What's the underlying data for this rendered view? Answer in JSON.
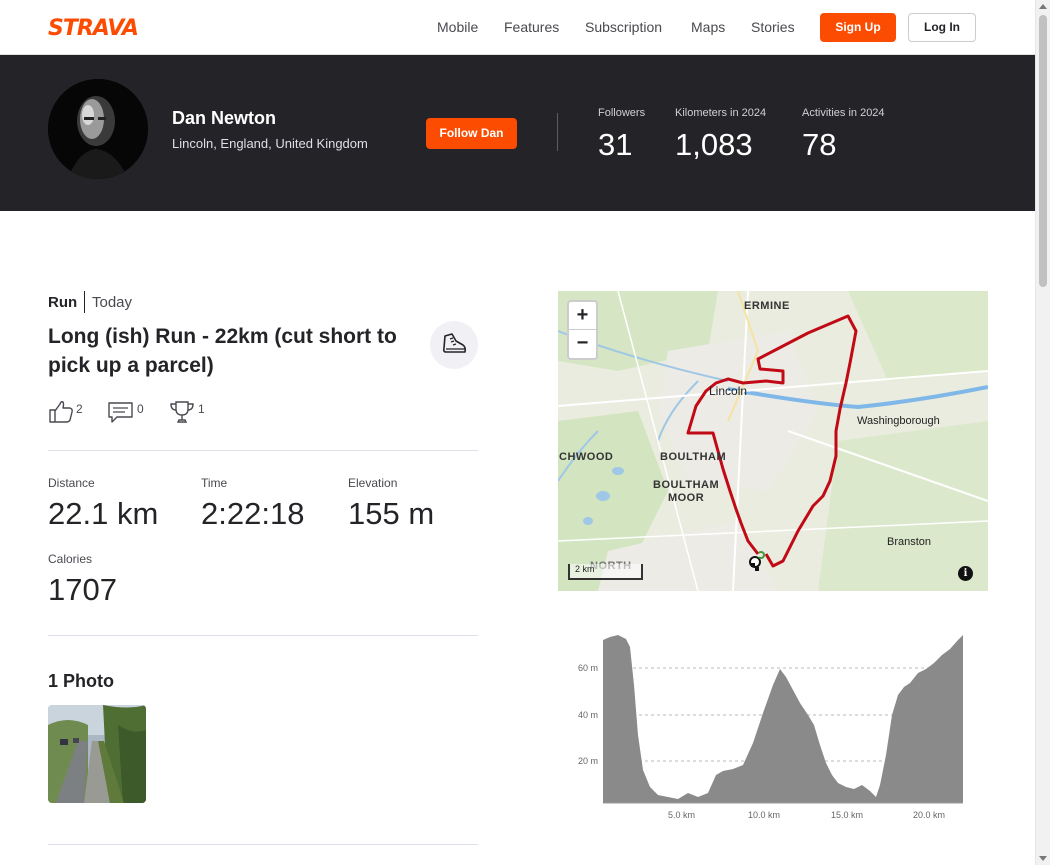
{
  "nav": {
    "logo": "STRAVA",
    "links": [
      "Mobile",
      "Features",
      "Subscription",
      "Maps",
      "Stories"
    ],
    "signup": "Sign Up",
    "login": "Log In"
  },
  "athlete": {
    "name": "Dan Newton",
    "location": "Lincoln, England, United Kingdom",
    "follow": "Follow Dan",
    "stats": [
      {
        "label": "Followers",
        "value": "31"
      },
      {
        "label": "Kilometers in 2024",
        "value": "1,083"
      },
      {
        "label": "Activities in 2024",
        "value": "78"
      }
    ]
  },
  "activity": {
    "type": "Run",
    "date": "Today",
    "title": "Long (ish) Run - 22km (cut short to pick up a parcel)",
    "kudos": "2",
    "comments": "0",
    "achievements": "1",
    "metrics": [
      {
        "label": "Distance",
        "value": "22.1 km"
      },
      {
        "label": "Time",
        "value": "2:22:18"
      },
      {
        "label": "Elevation",
        "value": "155 m"
      },
      {
        "label": "Calories",
        "value": "1707"
      }
    ],
    "photos_title": "1 Photo"
  },
  "map": {
    "zoom_in": "+",
    "zoom_out": "−",
    "labels": {
      "ermine": "ERMINE",
      "lincoln": "Lincoln",
      "washingborough": "Washingborough",
      "boultham": "BOULTHAM",
      "boultham_moor": "BOULTHAM\nMOOR",
      "birchwood": "CHWOOD",
      "branston": "Branston",
      "north": "NORTH"
    },
    "scale": "2 km",
    "info": "i",
    "route_color": "#c10a15"
  },
  "elevation": {
    "y_ticks": [
      "60 m",
      "40 m",
      "20 m"
    ],
    "x_ticks": [
      "5.0 km",
      "10.0 km",
      "15.0 km",
      "20.0 km"
    ]
  },
  "colors": {
    "brand": "#fc4c02",
    "header_bg": "#242428"
  }
}
